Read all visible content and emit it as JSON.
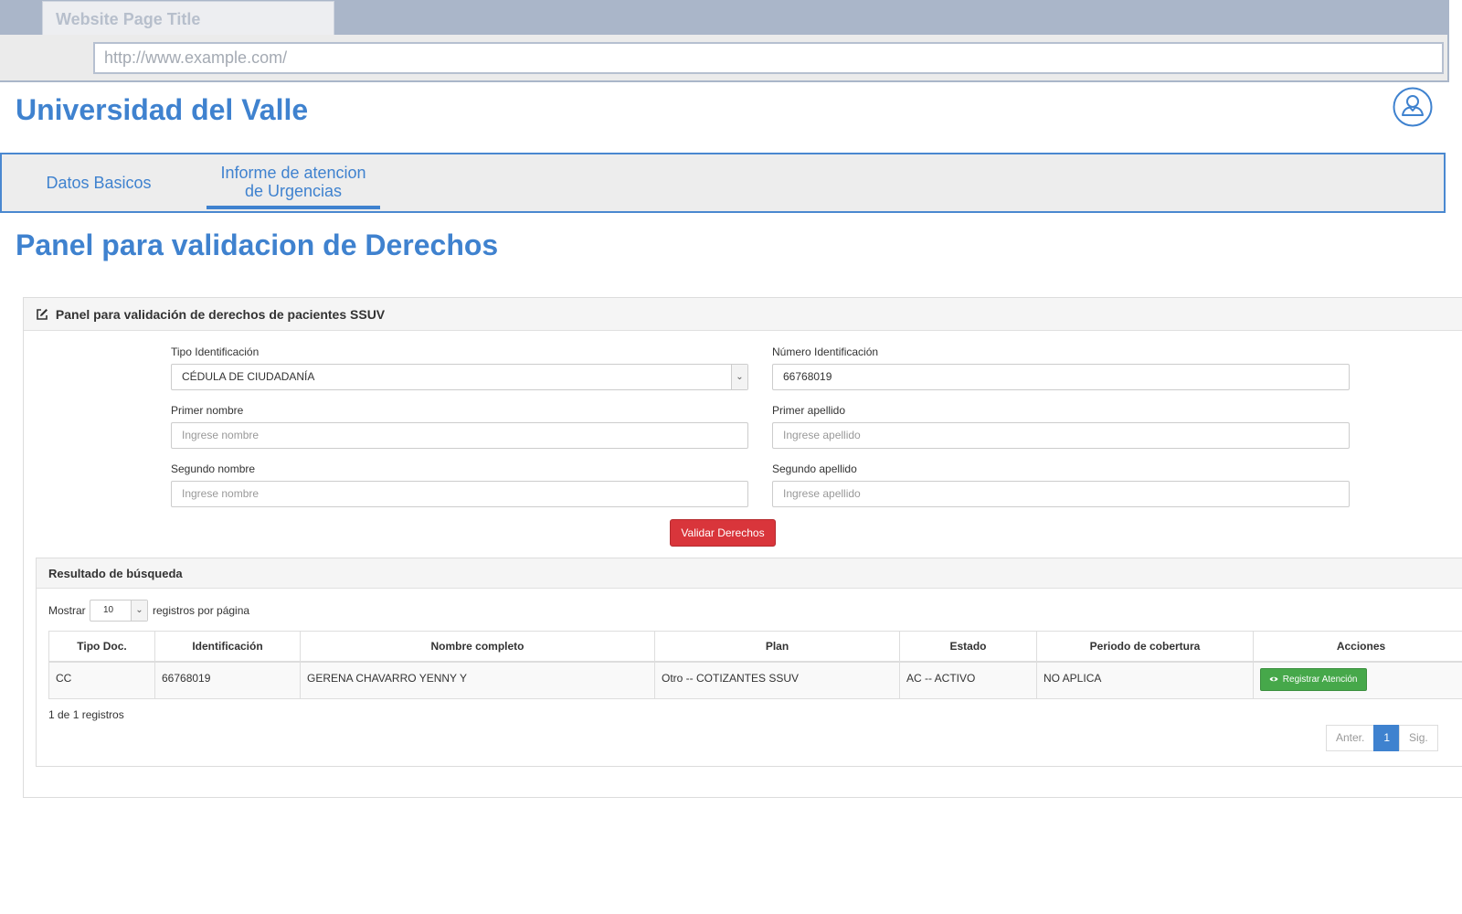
{
  "browser": {
    "tab_title": "Website Page Title",
    "url": "http://www.example.com/"
  },
  "header": {
    "site_title": "Universidad del Valle",
    "user_icon": "user-icon"
  },
  "nav": {
    "items": [
      {
        "label": "Datos Basicos"
      },
      {
        "label_line1": "Informe de atencion",
        "label_line2": "de Urgencias",
        "active": true
      }
    ]
  },
  "page": {
    "title": "Panel para validacion de Derechos"
  },
  "panel": {
    "heading": "Panel para validación de derechos de pacientes SSUV",
    "heading_icon": "edit-icon",
    "fields": {
      "tipo_id": {
        "label": "Tipo Identificación",
        "value": "CÉDULA DE CIUDADANÍA"
      },
      "numero_id": {
        "label": "Número Identificación",
        "value": "66768019"
      },
      "primer_nombre": {
        "label": "Primer nombre",
        "placeholder": "Ingrese nombre"
      },
      "primer_apellido": {
        "label": "Primer apellido",
        "placeholder": "Ingrese apellido"
      },
      "segundo_nombre": {
        "label": "Segundo nombre",
        "placeholder": "Ingrese nombre"
      },
      "segundo_apellido": {
        "label": "Segundo apellido",
        "placeholder": "Ingrese apellido"
      }
    },
    "validate_button": "Validar Derechos"
  },
  "results": {
    "heading": "Resultado de búsqueda",
    "show_label": "Mostrar",
    "page_length": "10",
    "per_page_label": "registros por página",
    "columns": [
      "Tipo Doc.",
      "Identificación",
      "Nombre completo",
      "Plan",
      "Estado",
      "Periodo de cobertura",
      "Acciones"
    ],
    "rows": [
      {
        "tipo_doc": "CC",
        "identificacion": "66768019",
        "nombre": "GERENA CHAVARRO YENNY Y",
        "plan": "Otro -- COTIZANTES SSUV",
        "estado": "AC -- ACTIVO",
        "periodo": "NO APLICA",
        "action_label": "Registrar Atención",
        "action_icon": "eye-icon"
      }
    ],
    "info": "1 de 1 registros",
    "pager": {
      "prev": "Anter.",
      "current": "1",
      "next": "Sig."
    }
  },
  "colors": {
    "brand_blue": "#3f82cf",
    "danger_red": "#d9353b",
    "success_green": "#46a84a"
  }
}
